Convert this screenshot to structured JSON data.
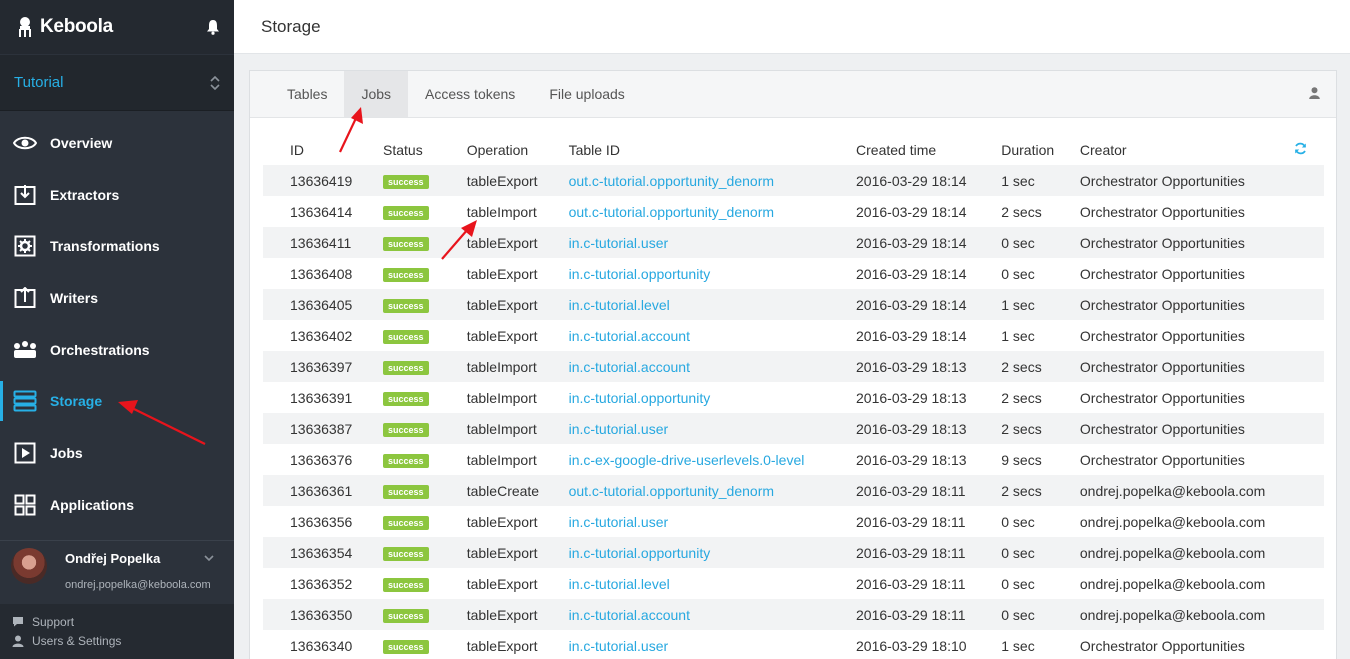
{
  "app": {
    "brand": "Keboola",
    "project": "Tutorial"
  },
  "sidebar": {
    "items": [
      {
        "label": "Overview",
        "icon": "eye-icon"
      },
      {
        "label": "Extractors",
        "icon": "download-box-icon"
      },
      {
        "label": "Transformations",
        "icon": "gear-box-icon"
      },
      {
        "label": "Writers",
        "icon": "upload-box-icon"
      },
      {
        "label": "Orchestrations",
        "icon": "orchestration-icon"
      },
      {
        "label": "Storage",
        "icon": "database-icon",
        "active": true
      },
      {
        "label": "Jobs",
        "icon": "play-box-icon"
      },
      {
        "label": "Applications",
        "icon": "grid-icon"
      }
    ],
    "user": {
      "name": "Ondřej Popelka",
      "email": "ondrej.popelka@keboola.com"
    },
    "links": {
      "support": "Support",
      "settings": "Users & Settings"
    }
  },
  "page": {
    "title": "Storage"
  },
  "tabs": [
    "Tables",
    "Jobs",
    "Access tokens",
    "File uploads"
  ],
  "active_tab": "Jobs",
  "table": {
    "headers": [
      "ID",
      "Status",
      "Operation",
      "Table ID",
      "Created time",
      "Duration",
      "Creator"
    ],
    "rows": [
      {
        "id": "13636419",
        "status": "success",
        "op": "tableExport",
        "table": "out.c-tutorial.opportunity_denorm",
        "time": "2016-03-29 18:14",
        "dur": "1 sec",
        "creator": "Orchestrator Opportunities"
      },
      {
        "id": "13636414",
        "status": "success",
        "op": "tableImport",
        "table": "out.c-tutorial.opportunity_denorm",
        "time": "2016-03-29 18:14",
        "dur": "2 secs",
        "creator": "Orchestrator Opportunities"
      },
      {
        "id": "13636411",
        "status": "success",
        "op": "tableExport",
        "table": "in.c-tutorial.user",
        "time": "2016-03-29 18:14",
        "dur": "0 sec",
        "creator": "Orchestrator Opportunities"
      },
      {
        "id": "13636408",
        "status": "success",
        "op": "tableExport",
        "table": "in.c-tutorial.opportunity",
        "time": "2016-03-29 18:14",
        "dur": "0 sec",
        "creator": "Orchestrator Opportunities"
      },
      {
        "id": "13636405",
        "status": "success",
        "op": "tableExport",
        "table": "in.c-tutorial.level",
        "time": "2016-03-29 18:14",
        "dur": "1 sec",
        "creator": "Orchestrator Opportunities"
      },
      {
        "id": "13636402",
        "status": "success",
        "op": "tableExport",
        "table": "in.c-tutorial.account",
        "time": "2016-03-29 18:14",
        "dur": "1 sec",
        "creator": "Orchestrator Opportunities"
      },
      {
        "id": "13636397",
        "status": "success",
        "op": "tableImport",
        "table": "in.c-tutorial.account",
        "time": "2016-03-29 18:13",
        "dur": "2 secs",
        "creator": "Orchestrator Opportunities"
      },
      {
        "id": "13636391",
        "status": "success",
        "op": "tableImport",
        "table": "in.c-tutorial.opportunity",
        "time": "2016-03-29 18:13",
        "dur": "2 secs",
        "creator": "Orchestrator Opportunities"
      },
      {
        "id": "13636387",
        "status": "success",
        "op": "tableImport",
        "table": "in.c-tutorial.user",
        "time": "2016-03-29 18:13",
        "dur": "2 secs",
        "creator": "Orchestrator Opportunities"
      },
      {
        "id": "13636376",
        "status": "success",
        "op": "tableImport",
        "table": "in.c-ex-google-drive-userlevels.0-level",
        "time": "2016-03-29 18:13",
        "dur": "9 secs",
        "creator": "Orchestrator Opportunities"
      },
      {
        "id": "13636361",
        "status": "success",
        "op": "tableCreate",
        "table": "out.c-tutorial.opportunity_denorm",
        "time": "2016-03-29 18:11",
        "dur": "2 secs",
        "creator": "ondrej.popelka@keboola.com"
      },
      {
        "id": "13636356",
        "status": "success",
        "op": "tableExport",
        "table": "in.c-tutorial.user",
        "time": "2016-03-29 18:11",
        "dur": "0 sec",
        "creator": "ondrej.popelka@keboola.com"
      },
      {
        "id": "13636354",
        "status": "success",
        "op": "tableExport",
        "table": "in.c-tutorial.opportunity",
        "time": "2016-03-29 18:11",
        "dur": "0 sec",
        "creator": "ondrej.popelka@keboola.com"
      },
      {
        "id": "13636352",
        "status": "success",
        "op": "tableExport",
        "table": "in.c-tutorial.level",
        "time": "2016-03-29 18:11",
        "dur": "0 sec",
        "creator": "ondrej.popelka@keboola.com"
      },
      {
        "id": "13636350",
        "status": "success",
        "op": "tableExport",
        "table": "in.c-tutorial.account",
        "time": "2016-03-29 18:11",
        "dur": "0 sec",
        "creator": "ondrej.popelka@keboola.com"
      },
      {
        "id": "13636340",
        "status": "success",
        "op": "tableExport",
        "table": "in.c-tutorial.user",
        "time": "2016-03-29 18:10",
        "dur": "1 sec",
        "creator": "Orchestrator Opportunities"
      }
    ]
  },
  "colors": {
    "accent": "#27b0e6",
    "success": "#8cc63f",
    "sidebar": "#2c323b",
    "annotation": "#e8141c"
  }
}
